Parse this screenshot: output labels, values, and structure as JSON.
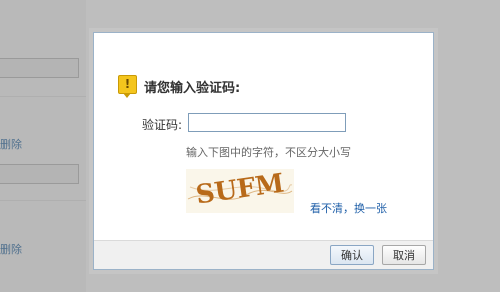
{
  "background": {
    "links": [
      "删除",
      "删除"
    ]
  },
  "dialog": {
    "icon": "warning-icon",
    "prompt": "请您输入验证码:",
    "field_label": "验证码:",
    "captcha_value": "",
    "hint": "输入下图中的字符，不区分大小写",
    "captcha_text": "SUFM",
    "refresh_link": "看不清，换一张",
    "ok_label": "确认",
    "cancel_label": "取消"
  },
  "colors": {
    "captcha_ink": "#b86a1a",
    "link": "#1f5fa8",
    "icon_bg": "#f4c51d"
  }
}
